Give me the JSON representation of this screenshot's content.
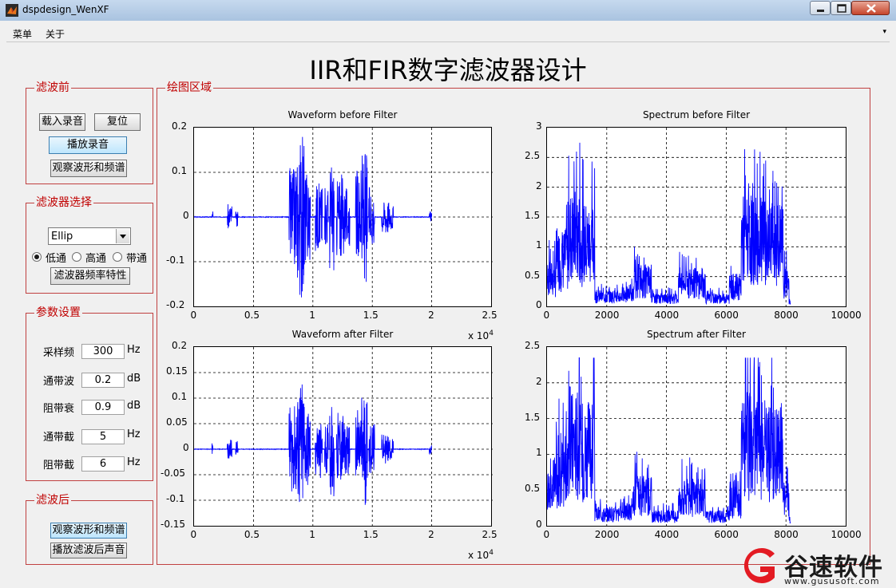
{
  "window": {
    "title": "dspdesign_WenXF"
  },
  "menu": {
    "items": [
      "菜单",
      "关于"
    ]
  },
  "main_title": "IIR和FIR数字滤波器设计",
  "panels": {
    "before": {
      "title": "滤波前",
      "load_label": "载入录音",
      "reset_label": "复位",
      "play_label": "播放录音",
      "view_label": "观察波形和频谱"
    },
    "filter": {
      "title": "滤波器选择",
      "type_selected": "Ellip",
      "options": [
        "低通",
        "高通",
        "带通"
      ],
      "freq_label": "滤波器频率特性"
    },
    "params": {
      "title": "参数设置",
      "rows": [
        {
          "label": "采样频",
          "value": "300",
          "unit": "Hz"
        },
        {
          "label": "通带波",
          "value": "0.2",
          "unit": "dB"
        },
        {
          "label": "阻带衰",
          "value": "0.9",
          "unit": "dB"
        },
        {
          "label": "通带截",
          "value": "5",
          "unit": "Hz"
        },
        {
          "label": "阻带截",
          "value": "6",
          "unit": "Hz"
        }
      ]
    },
    "after": {
      "title": "滤波后",
      "view_label": "观察波形和频谱",
      "play_label": "播放滤波后声音"
    },
    "plot_area": {
      "title": "绘图区域"
    }
  },
  "chart_data": [
    {
      "type": "line",
      "title": "Waveform before Filter",
      "x_ticks": [
        "0",
        "0.5",
        "1",
        "1.5",
        "2",
        "2.5"
      ],
      "y_ticks": [
        "0.2",
        "0.1",
        "0",
        "-0.1",
        "-0.2"
      ],
      "xlim": [
        0,
        25000
      ],
      "ylim": [
        -0.2,
        0.2
      ],
      "x_multiplier": "x 10",
      "x_exponent": "4",
      "grid": true,
      "color": "#0000ff"
    },
    {
      "type": "line",
      "title": "Spectrum before Filter",
      "x_ticks": [
        "0",
        "2000",
        "4000",
        "6000",
        "8000",
        "10000"
      ],
      "y_ticks": [
        "3",
        "2.5",
        "2",
        "1.5",
        "1",
        "0.5",
        "0"
      ],
      "xlim": [
        0,
        10000
      ],
      "ylim": [
        0,
        3
      ],
      "grid": true,
      "color": "#0000ff"
    },
    {
      "type": "line",
      "title": "Waveform after Filter",
      "x_ticks": [
        "0",
        "0.5",
        "1",
        "1.5",
        "2",
        "2.5"
      ],
      "y_ticks": [
        "0.2",
        "0.15",
        "0.1",
        "0.05",
        "0",
        "-0.05",
        "-0.1",
        "-0.15"
      ],
      "xlim": [
        0,
        25000
      ],
      "ylim": [
        -0.15,
        0.2
      ],
      "x_multiplier": "x 10",
      "x_exponent": "4",
      "grid": true,
      "color": "#0000ff"
    },
    {
      "type": "line",
      "title": "Spectrum after Filter",
      "x_ticks": [
        "0",
        "2000",
        "4000",
        "6000",
        "8000",
        "10000"
      ],
      "y_ticks": [
        "2.5",
        "2",
        "1.5",
        "1",
        "0.5",
        "0"
      ],
      "xlim": [
        0,
        10000
      ],
      "ylim": [
        0,
        2.5
      ],
      "grid": true,
      "color": "#0000ff"
    }
  ],
  "watermark": {
    "text": "谷速软件",
    "url": "www.gususoft.com"
  }
}
